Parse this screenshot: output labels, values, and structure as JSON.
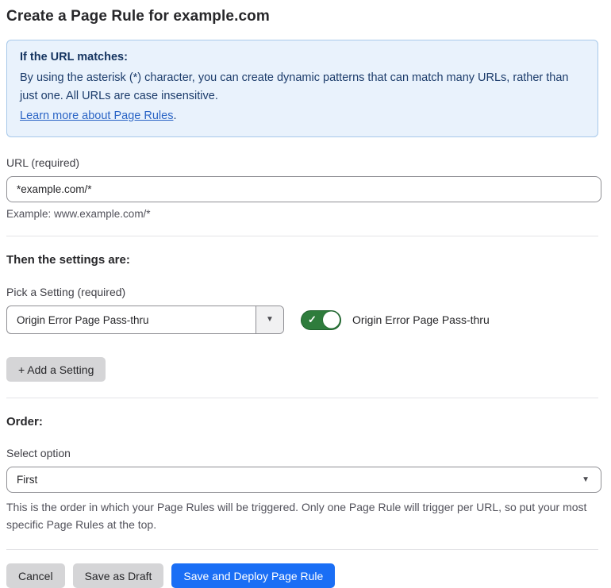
{
  "page": {
    "title": "Create a Page Rule for example.com"
  },
  "info_box": {
    "heading": "If the URL matches:",
    "body": "By using the asterisk (*) character, you can create dynamic patterns that can match many URLs, rather than just one. All URLs are case insensitive.",
    "link": "Learn more about Page Rules",
    "link_suffix": "."
  },
  "url_field": {
    "label": "URL (required)",
    "value": "*example.com/*",
    "example": "Example: www.example.com/*"
  },
  "settings": {
    "heading": "Then the settings are:",
    "picker_label": "Pick a Setting (required)",
    "selected_setting": "Origin Error Page Pass-thru",
    "dropdown_caret": "▼",
    "toggle": {
      "state": "on",
      "check_glyph": "✓",
      "label": "Origin Error Page Pass-thru"
    },
    "add_button": "+ Add a Setting"
  },
  "order": {
    "heading": "Order:",
    "select_label": "Select option",
    "selected_option": "First",
    "dropdown_caret": "▼",
    "help": "This is the order in which your Page Rules will be triggered. Only one Page Rule will trigger per URL, so put your most specific Page Rules at the top."
  },
  "footer": {
    "cancel": "Cancel",
    "save_draft": "Save as Draft",
    "save_deploy": "Save and Deploy Page Rule"
  },
  "colors": {
    "info_bg": "#e9f2fc",
    "info_border": "#a7c8ea",
    "info_text": "#1c3c6b",
    "link": "#2a64c5",
    "toggle_on": "#2e7c3c",
    "primary_button": "#1a6ef5",
    "secondary_button": "#d5d5d7",
    "input_border": "#8f8f94",
    "divider": "#e4e4e7"
  }
}
